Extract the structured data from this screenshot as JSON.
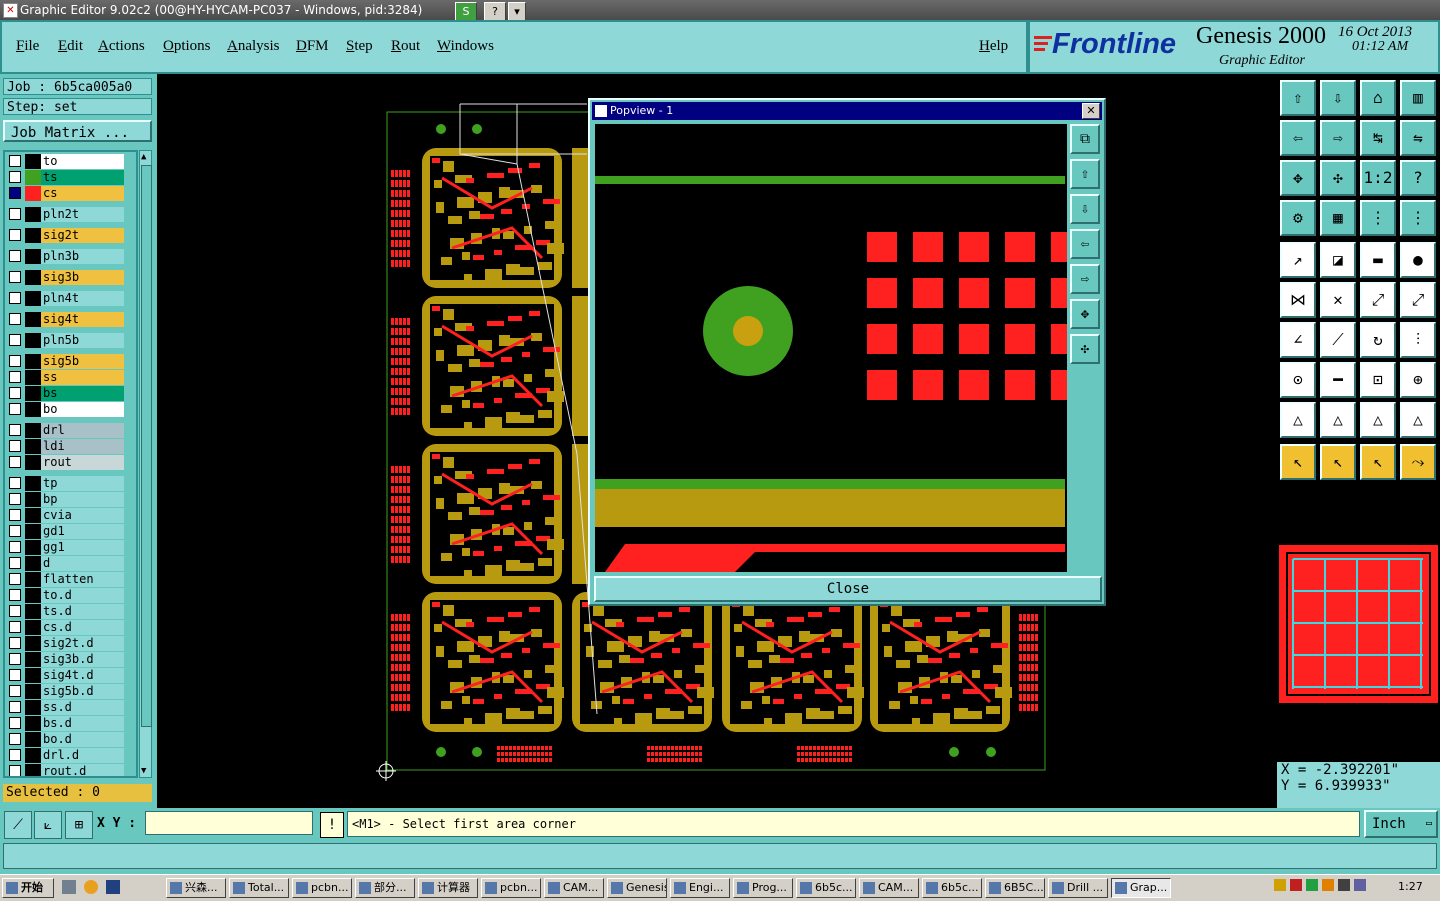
{
  "window": {
    "title": "Graphic Editor 9.02c2 (00@HY-HYCAM-PC037 - Windows, pid:3284)",
    "title_buttons": [
      "S",
      "?",
      "▾"
    ]
  },
  "menu": {
    "items": [
      "File",
      "Edit",
      "Actions",
      "Options",
      "Analysis",
      "DFM",
      "Step",
      "Rout",
      "Windows"
    ],
    "help": "Help"
  },
  "brand": {
    "logo": "Frontline",
    "product": "Genesis 2000",
    "subtitle": "Graphic Editor",
    "date": "16 Oct 2013",
    "time": "01:12 AM"
  },
  "job": {
    "job_line": "Job : 6b5ca005a0",
    "step_line": "Step: set",
    "matrix_button": "Job Matrix ..."
  },
  "layers": [
    {
      "name": "to",
      "bg": "#ffffff",
      "swatch": "",
      "checked": false
    },
    {
      "name": "ts",
      "bg": "#00a070",
      "swatch": "#40a020",
      "checked": false
    },
    {
      "name": "cs",
      "bg": "#f0c040",
      "swatch": "#ff2020",
      "checked": true
    },
    {
      "name": "pln2t",
      "bg": "#8fd8d8",
      "swatch": "",
      "checked": false
    },
    {
      "name": "sig2t",
      "bg": "#f0c040",
      "swatch": "",
      "checked": false
    },
    {
      "name": "pln3b",
      "bg": "#8fd8d8",
      "swatch": "",
      "checked": false
    },
    {
      "name": "sig3b",
      "bg": "#f0c040",
      "swatch": "",
      "checked": false
    },
    {
      "name": "pln4t",
      "bg": "#8fd8d8",
      "swatch": "",
      "checked": false
    },
    {
      "name": "sig4t",
      "bg": "#f0c040",
      "swatch": "",
      "checked": false
    },
    {
      "name": "pln5b",
      "bg": "#8fd8d8",
      "swatch": "",
      "checked": false
    },
    {
      "name": "sig5b",
      "bg": "#f0c040",
      "swatch": "",
      "checked": false
    },
    {
      "name": "ss",
      "bg": "#f0c040",
      "swatch": "",
      "checked": false
    },
    {
      "name": "bs",
      "bg": "#00a070",
      "swatch": "",
      "checked": false
    },
    {
      "name": "bo",
      "bg": "#ffffff",
      "swatch": "",
      "checked": false
    },
    {
      "name": "drl",
      "bg": "#a8c0c8",
      "swatch": "",
      "checked": false
    },
    {
      "name": "ldi",
      "bg": "#a8c0c8",
      "swatch": "",
      "checked": false
    },
    {
      "name": "rout",
      "bg": "#c8d8d8",
      "swatch": "",
      "checked": false
    },
    {
      "name": "tp",
      "bg": "#8fd8d8",
      "swatch": "",
      "checked": false
    },
    {
      "name": "bp",
      "bg": "#8fd8d8",
      "swatch": "",
      "checked": false
    },
    {
      "name": "cvia",
      "bg": "#8fd8d8",
      "swatch": "",
      "checked": false
    },
    {
      "name": "gd1",
      "bg": "#8fd8d8",
      "swatch": "",
      "checked": false
    },
    {
      "name": "gg1",
      "bg": "#8fd8d8",
      "swatch": "",
      "checked": false
    },
    {
      "name": "d",
      "bg": "#8fd8d8",
      "swatch": "",
      "checked": false
    },
    {
      "name": "flatten",
      "bg": "#8fd8d8",
      "swatch": "",
      "checked": false
    },
    {
      "name": "to.d",
      "bg": "#8fd8d8",
      "swatch": "",
      "checked": false
    },
    {
      "name": "ts.d",
      "bg": "#8fd8d8",
      "swatch": "",
      "checked": false
    },
    {
      "name": "cs.d",
      "bg": "#8fd8d8",
      "swatch": "",
      "checked": false
    },
    {
      "name": "sig2t.d",
      "bg": "#8fd8d8",
      "swatch": "",
      "checked": false
    },
    {
      "name": "sig3b.d",
      "bg": "#8fd8d8",
      "swatch": "",
      "checked": false
    },
    {
      "name": "sig4t.d",
      "bg": "#8fd8d8",
      "swatch": "",
      "checked": false
    },
    {
      "name": "sig5b.d",
      "bg": "#8fd8d8",
      "swatch": "",
      "checked": false
    },
    {
      "name": "ss.d",
      "bg": "#8fd8d8",
      "swatch": "",
      "checked": false
    },
    {
      "name": "bs.d",
      "bg": "#8fd8d8",
      "swatch": "",
      "checked": false
    },
    {
      "name": "bo.d",
      "bg": "#8fd8d8",
      "swatch": "",
      "checked": false
    },
    {
      "name": "drl.d",
      "bg": "#8fd8d8",
      "swatch": "",
      "checked": false
    },
    {
      "name": "rout.d",
      "bg": "#8fd8d8",
      "swatch": "",
      "checked": false
    }
  ],
  "selection": {
    "text": "Selected : 0"
  },
  "popview": {
    "title": "Popview - 1",
    "close_button": "Close",
    "close_x": "✕"
  },
  "coordinates": {
    "x": "X = -2.392201\"",
    "y": "Y = 6.939933\""
  },
  "command": {
    "xy_label": "X Y :",
    "xy_value": "",
    "prompt": "<M1> - Select first area corner",
    "units": "Inch",
    "info_icon": "!"
  },
  "taskbar": {
    "start": "开始",
    "items": [
      "兴森...",
      "Total...",
      "pcbn...",
      "部分...",
      "计算器",
      "pcbn...",
      "CAM...",
      "Genesis",
      "Engi...",
      "Prog...",
      "6b5c...",
      "CAM...",
      "6b5c...",
      "6B5C...",
      "Drill ...",
      "Grap..."
    ],
    "clock": "1:27"
  },
  "colors": {
    "panel": "#68c8c0",
    "panel_light": "#8fd8d8",
    "copper_red": "#ff2020",
    "soldermask_olive": "#b89a10",
    "silkscreen_green": "#40a020"
  }
}
